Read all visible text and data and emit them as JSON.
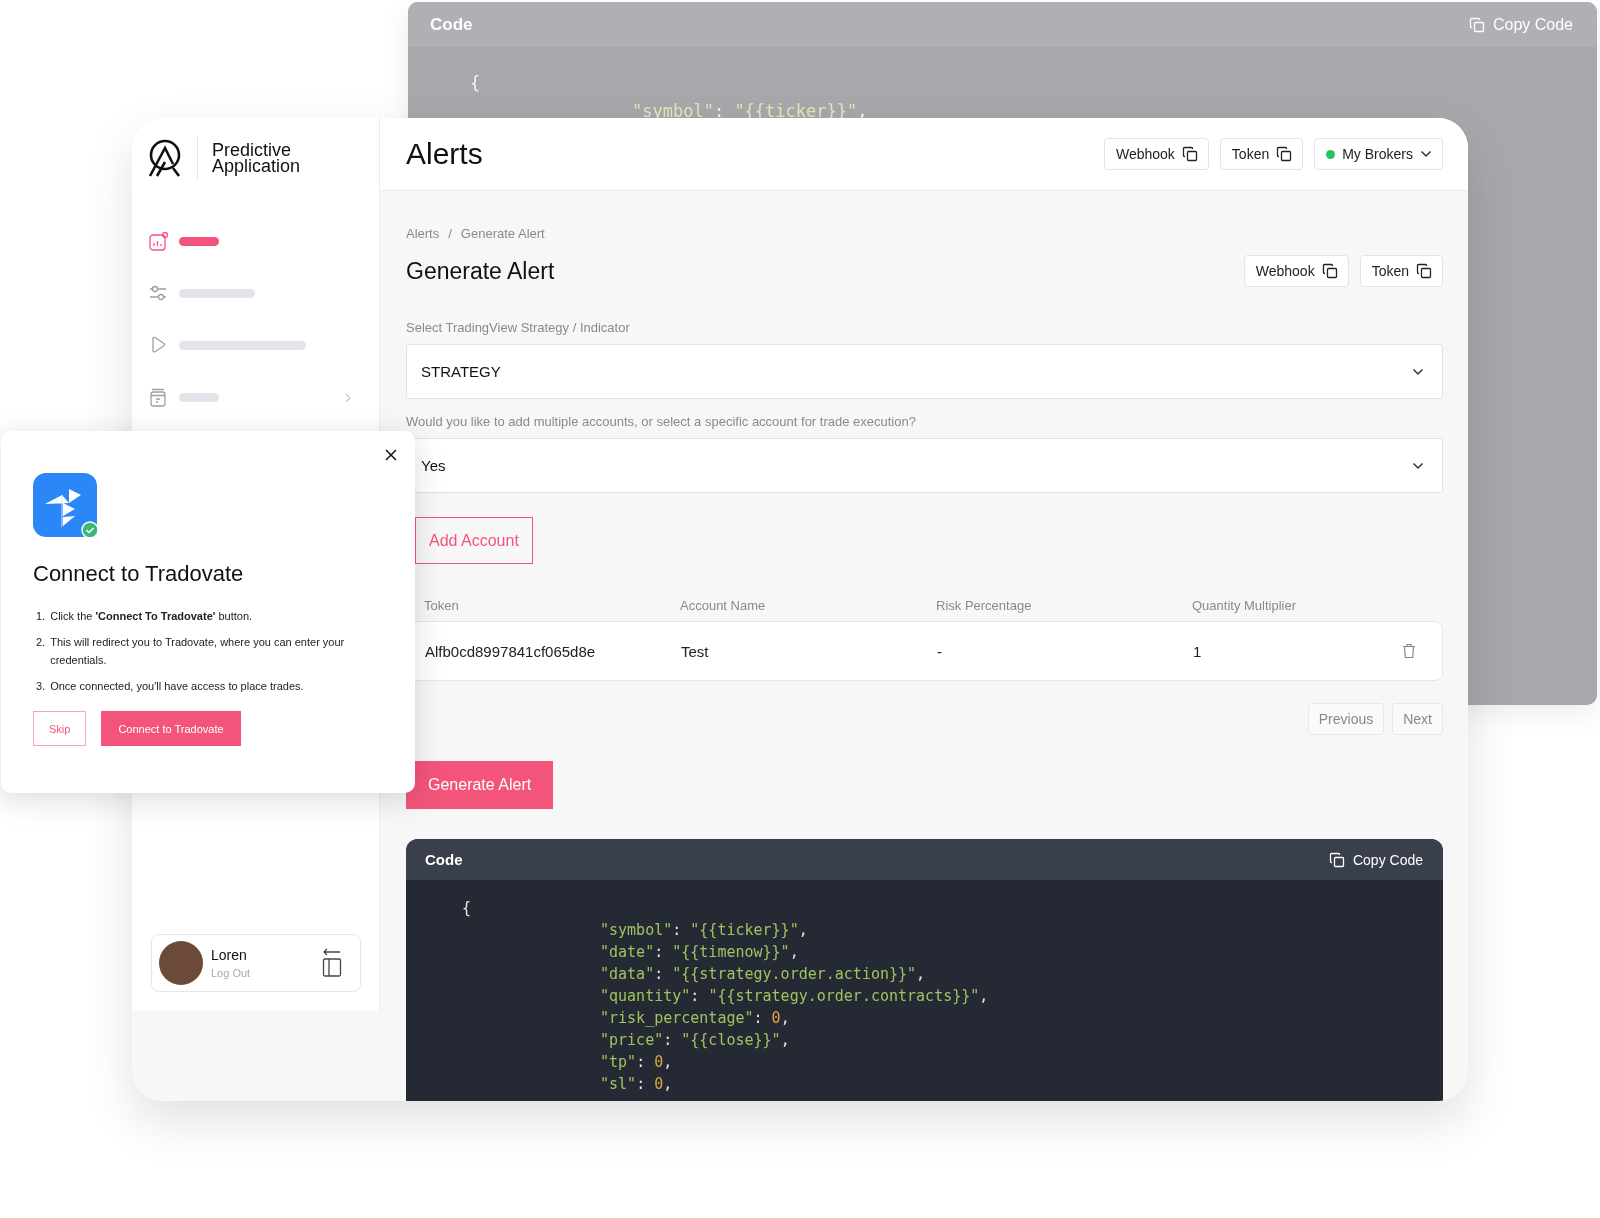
{
  "background_window": {
    "title": "Code",
    "copy_label": "Copy Code",
    "code_lines": [
      {
        "kind": "open",
        "parts": [
          {
            "kind": "punct",
            "text": "{"
          }
        ]
      },
      {
        "kind": "field",
        "parts": [
          {
            "kind": "string",
            "text": "\"symbol\""
          },
          {
            "kind": "punct",
            "text": ": "
          },
          {
            "kind": "string",
            "text": "\"{{ticker}}\""
          },
          {
            "kind": "punct",
            "text": ","
          }
        ]
      }
    ]
  },
  "app": {
    "name": "Predictive Application",
    "sidebar": {
      "items": [
        {
          "kind": "chart",
          "selected": true,
          "has_submenu": false
        },
        {
          "kind": "sliders",
          "selected": false,
          "has_submenu": false
        },
        {
          "kind": "play",
          "selected": false,
          "has_submenu": false
        },
        {
          "kind": "archive",
          "selected": false,
          "has_submenu": true
        }
      ]
    },
    "user": {
      "name": "Loren",
      "action": "Log Out"
    }
  },
  "header": {
    "title": "Alerts",
    "buttons": [
      {
        "label": "Webhook"
      },
      {
        "label": "Token"
      }
    ],
    "broker_menu": {
      "label": "My Brokers",
      "color": "#22c55e"
    }
  },
  "breadcrumbs": {
    "items": [
      "Alerts",
      "Generate Alert"
    ],
    "separator": "/"
  },
  "page": {
    "title": "Generate Alert",
    "buttons": [
      {
        "label": "Webhook"
      },
      {
        "label": "Token"
      }
    ]
  },
  "fields": [
    {
      "label": "Select TradingView Strategy / Indicator",
      "value": "STRATEGY"
    },
    {
      "label": "Would you like to add multiple accounts, or select a specific account for trade execution?",
      "value": "Yes"
    }
  ],
  "add_account_button": "Add Account",
  "table": {
    "columns": [
      "Token",
      "Account Name",
      "Risk Percentage",
      "Quantity Multiplier"
    ],
    "rows": [
      {
        "cells": [
          "Alfb0cd8997841cf065d8e",
          "Test",
          "-",
          "1"
        ]
      }
    ]
  },
  "pagination": {
    "previous": "Previous",
    "next": "Next"
  },
  "generate_button": "Generate Alert",
  "code_card": {
    "title": "Code",
    "copy_label": "Copy Code",
    "code_lines": [
      {
        "kind": "open",
        "parts": [
          {
            "kind": "punct",
            "text": "{"
          }
        ]
      },
      {
        "kind": "field",
        "parts": [
          {
            "kind": "string",
            "text": "\"symbol\""
          },
          {
            "kind": "punct",
            "text": ": "
          },
          {
            "kind": "string",
            "text": "\"{{ticker}}\""
          },
          {
            "kind": "punct",
            "text": ","
          }
        ]
      },
      {
        "kind": "field",
        "parts": [
          {
            "kind": "string",
            "text": "\"date\""
          },
          {
            "kind": "punct",
            "text": ": "
          },
          {
            "kind": "string",
            "text": "\"{{timenow}}\""
          },
          {
            "kind": "punct",
            "text": ","
          }
        ]
      },
      {
        "kind": "field",
        "parts": [
          {
            "kind": "string",
            "text": "\"data\""
          },
          {
            "kind": "punct",
            "text": ": "
          },
          {
            "kind": "string",
            "text": "\"{{strategy.order.action}}\""
          },
          {
            "kind": "punct",
            "text": ","
          }
        ]
      },
      {
        "kind": "field",
        "parts": [
          {
            "kind": "string",
            "text": "\"quantity\""
          },
          {
            "kind": "punct",
            "text": ": "
          },
          {
            "kind": "string",
            "text": "\"{{strategy.order.contracts}}\""
          },
          {
            "kind": "punct",
            "text": ","
          }
        ]
      },
      {
        "kind": "field",
        "parts": [
          {
            "kind": "string",
            "text": "\"risk_percentage\""
          },
          {
            "kind": "punct",
            "text": ": "
          },
          {
            "kind": "number",
            "text": "0"
          },
          {
            "kind": "punct",
            "text": ","
          }
        ]
      },
      {
        "kind": "field",
        "parts": [
          {
            "kind": "string",
            "text": "\"price\""
          },
          {
            "kind": "punct",
            "text": ": "
          },
          {
            "kind": "string",
            "text": "\"{{close}}\""
          },
          {
            "kind": "punct",
            "text": ","
          }
        ]
      },
      {
        "kind": "field",
        "parts": [
          {
            "kind": "string",
            "text": "\"tp\""
          },
          {
            "kind": "punct",
            "text": ": "
          },
          {
            "kind": "number",
            "text": "0"
          },
          {
            "kind": "punct",
            "text": ","
          }
        ]
      },
      {
        "kind": "field",
        "parts": [
          {
            "kind": "string",
            "text": "\"sl\""
          },
          {
            "kind": "punct",
            "text": ": "
          },
          {
            "kind": "number",
            "text": "0"
          },
          {
            "kind": "punct",
            "text": ","
          }
        ]
      }
    ]
  },
  "modal": {
    "title": "Connect to Tradovate",
    "connected": true,
    "steps": [
      {
        "number": "1.",
        "text": "Click the **'Connect To Tradovate'** button."
      },
      {
        "number": "2.",
        "text": "This will redirect you to Tradovate, where you can enter your credentials."
      },
      {
        "number": "3.",
        "text": "Once connected, you'll have access to place trades."
      }
    ],
    "buttons": [
      {
        "kind": "outline",
        "label": "Skip"
      },
      {
        "kind": "primary",
        "label": "Connect to Tradovate"
      }
    ]
  }
}
